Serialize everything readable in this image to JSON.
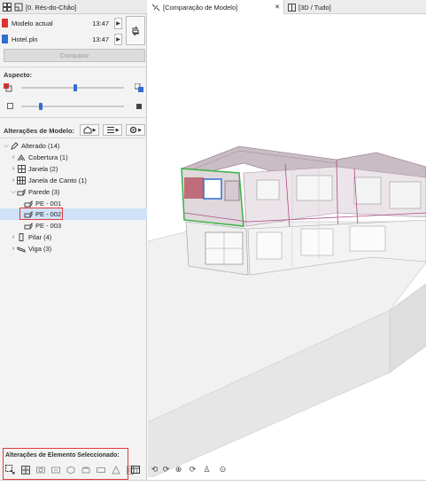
{
  "left_tabbar": {
    "label": "[0. Rés-do-Chão]"
  },
  "models": [
    {
      "name": "Modelo actual",
      "time": "13:47",
      "color": "#e03131"
    },
    {
      "name": "Hotel.pln",
      "time": "13:47",
      "color": "#2f6fd0"
    }
  ],
  "compare_label": "Comparar",
  "aspect_label": "Aspecto:",
  "changes_label": "Alterações de Modelo:",
  "tree": {
    "root": {
      "label": "Alterado",
      "count": "(14)"
    },
    "items": [
      {
        "label": "Cobertura (1)"
      },
      {
        "label": "Janela (2)"
      },
      {
        "label": "Janela de Canto (1)"
      },
      {
        "label": "Parede (3)"
      },
      {
        "label": "PE - 001"
      },
      {
        "label": "PE - 002"
      },
      {
        "label": "PE - 003"
      },
      {
        "label": "Pilar (4)"
      },
      {
        "label": "Viga (3)"
      }
    ]
  },
  "selected_changes_label": "Alterações de Elemento Seleccionado:",
  "right_tabs": [
    {
      "label": "[Comparação de Modelo]",
      "close": "✕"
    },
    {
      "label": "[3D / Tudo]"
    }
  ],
  "colors": {
    "current_model": "#e03131",
    "reference_model": "#2f6fd0",
    "selection_highlight": "#e23a3a",
    "selected_row": "#cfe2f7"
  }
}
